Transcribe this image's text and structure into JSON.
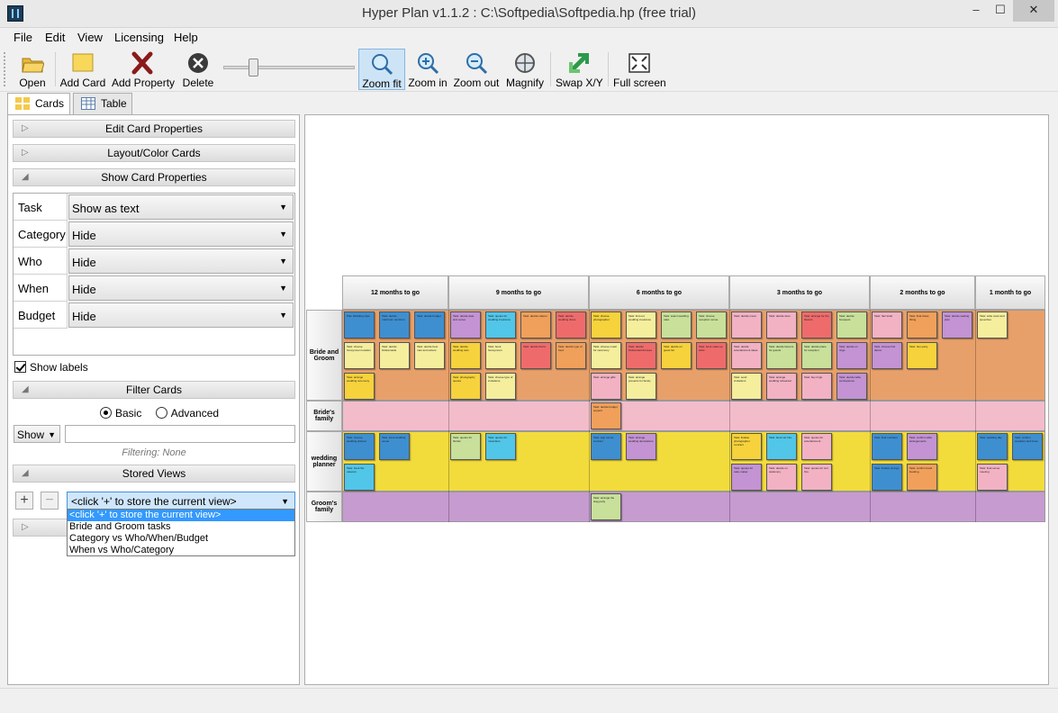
{
  "window": {
    "title": "Hyper Plan v1.1.2 : C:\\Softpedia\\Softpedia.hp (free trial)",
    "minimize": "–",
    "maximize": "☐",
    "close": "✕"
  },
  "menu": [
    "File",
    "Edit",
    "View",
    "Licensing",
    "Help"
  ],
  "toolbar": {
    "open": "Open",
    "add_card": "Add Card",
    "add_property": "Add Property",
    "delete": "Delete",
    "zoom_fit": "Zoom fit",
    "zoom_in": "Zoom in",
    "zoom_out": "Zoom out",
    "magnify": "Magnify",
    "swap": "Swap X/Y",
    "fullscreen": "Full screen",
    "active_tool": "Zoom fit"
  },
  "tabs": {
    "cards": "Cards",
    "table": "Table",
    "active": "Cards"
  },
  "panel": {
    "edit_props": "Edit Card Properties",
    "layout_color": "Layout/Color Cards",
    "show_props": "Show Card Properties",
    "properties": [
      {
        "label": "Task",
        "value": "Show as text"
      },
      {
        "label": "Category",
        "value": "Hide"
      },
      {
        "label": "Who",
        "value": "Hide"
      },
      {
        "label": "When",
        "value": "Hide"
      },
      {
        "label": "Budget",
        "value": "Hide"
      }
    ],
    "show_labels": "Show labels",
    "show_labels_checked": true,
    "filter_cards": "Filter Cards",
    "basic": "Basic",
    "advanced": "Advanced",
    "filter_mode": "Basic",
    "show_select": "Show",
    "filter_value": "",
    "filtering": "Filtering: None",
    "stored_views": "Stored Views",
    "add_view": "+",
    "remove_view": "−",
    "view_select": "<click '+' to store the current view>",
    "view_options": [
      "<click '+' to store the current view>",
      "Bride and Groom tasks",
      "Category vs Who/When/Budget",
      "When vs Who/Category"
    ]
  },
  "board": {
    "columns": [
      "12 months to go",
      "9 months to go",
      "6 months to go",
      "3 months to go",
      "2 months to go",
      "1 month to go"
    ],
    "rows": [
      "Bride and Groom",
      "Bride's family",
      "wedding planner",
      "Groom's family"
    ],
    "row_colors": [
      "#e8a06a",
      "#f3bccb",
      "#f2dc3c",
      "#c69bd0"
    ],
    "card_colors": {
      "blue": "#3e8fd0",
      "cyan": "#51c6e8",
      "yellow": "#f6d23c",
      "orange": "#f0a05a",
      "red": "#ef6b6b",
      "green": "#c8e09a",
      "lightyellow": "#f4ee9d",
      "pink": "#f2b2c4",
      "purple": "#c393d3"
    },
    "cards": [
      {
        "row": 0,
        "col": 0,
        "slot": 0,
        "line": 0,
        "color": "blue",
        "text": "Plan Wedding style"
      },
      {
        "row": 0,
        "col": 0,
        "slot": 1,
        "line": 0,
        "color": "blue",
        "text": "Task: decide maximum numbers"
      },
      {
        "row": 0,
        "col": 0,
        "slot": 2,
        "line": 0,
        "color": "blue",
        "text": "Task: decide budget"
      },
      {
        "row": 0,
        "col": 0,
        "slot": 0,
        "line": 1,
        "color": "lightyellow",
        "text": "Task: choose honeymoon location"
      },
      {
        "row": 0,
        "col": 0,
        "slot": 1,
        "line": 1,
        "color": "lightyellow",
        "text": "Task: decide bridesmaids"
      },
      {
        "row": 0,
        "col": 0,
        "slot": 2,
        "line": 1,
        "color": "lightyellow",
        "text": "Task: decide best man and ushers"
      },
      {
        "row": 0,
        "col": 0,
        "slot": 0,
        "line": 2,
        "color": "yellow",
        "text": "Task: arrange wedding ceremony"
      },
      {
        "row": 0,
        "col": 1,
        "slot": 0,
        "line": 0,
        "color": "purple",
        "text": "Task: decide date and venue"
      },
      {
        "row": 0,
        "col": 1,
        "slot": 1,
        "line": 0,
        "color": "cyan",
        "text": "Task: quotes for wedding insurance"
      },
      {
        "row": 0,
        "col": 1,
        "slot": 2,
        "line": 0,
        "color": "orange",
        "text": "Task: decide caterer"
      },
      {
        "row": 0,
        "col": 1,
        "slot": 3,
        "line": 0,
        "color": "red",
        "text": "Task: decide wedding dress"
      },
      {
        "row": 0,
        "col": 1,
        "slot": 0,
        "line": 1,
        "color": "yellow",
        "text": "Task: decide wedding cars"
      },
      {
        "row": 0,
        "col": 1,
        "slot": 1,
        "line": 1,
        "color": "lightyellow",
        "text": "Task: book honeymoon"
      },
      {
        "row": 0,
        "col": 1,
        "slot": 2,
        "line": 1,
        "color": "red",
        "text": "Task: decide florist"
      },
      {
        "row": 0,
        "col": 1,
        "slot": 3,
        "line": 1,
        "color": "orange",
        "text": "Task: decide type of food"
      },
      {
        "row": 0,
        "col": 1,
        "slot": 0,
        "line": 2,
        "color": "yellow",
        "text": "Task: photography quotes"
      },
      {
        "row": 0,
        "col": 1,
        "slot": 1,
        "line": 2,
        "color": "lightyellow",
        "text": "Task: choose type of invitations"
      },
      {
        "row": 0,
        "col": 2,
        "slot": 0,
        "line": 0,
        "color": "yellow",
        "text": "Task: choose photographer"
      },
      {
        "row": 0,
        "col": 2,
        "slot": 1,
        "line": 0,
        "color": "lightyellow",
        "text": "Task: find out wedding insurance"
      },
      {
        "row": 0,
        "col": 2,
        "slot": 2,
        "line": 0,
        "color": "green",
        "text": "Task: select wedding cake"
      },
      {
        "row": 0,
        "col": 2,
        "slot": 3,
        "line": 0,
        "color": "green",
        "text": "Task: choose reception venue"
      },
      {
        "row": 0,
        "col": 2,
        "slot": 0,
        "line": 1,
        "color": "lightyellow",
        "text": "Task: choose music for ceremony"
      },
      {
        "row": 0,
        "col": 2,
        "slot": 1,
        "line": 1,
        "color": "red",
        "text": "Task: decide bridesmaid dresses"
      },
      {
        "row": 0,
        "col": 2,
        "slot": 2,
        "line": 1,
        "color": "yellow",
        "text": "Task: decide on guest list"
      },
      {
        "row": 0,
        "col": 2,
        "slot": 3,
        "line": 1,
        "color": "red",
        "text": "Task: book make up artist"
      },
      {
        "row": 0,
        "col": 2,
        "slot": 0,
        "line": 2,
        "color": "pink",
        "text": "Task: arrange gifts"
      },
      {
        "row": 0,
        "col": 2,
        "slot": 1,
        "line": 2,
        "color": "lightyellow",
        "text": "Task: arrange presents for family"
      },
      {
        "row": 0,
        "col": 3,
        "slot": 0,
        "line": 0,
        "color": "pink",
        "text": "Task: decide menu"
      },
      {
        "row": 0,
        "col": 3,
        "slot": 1,
        "line": 0,
        "color": "pink",
        "text": "Task: decide wine"
      },
      {
        "row": 0,
        "col": 3,
        "slot": 2,
        "line": 0,
        "color": "red",
        "text": "Task: arrange for the flowers"
      },
      {
        "row": 0,
        "col": 3,
        "slot": 3,
        "line": 0,
        "color": "green",
        "text": "Task: decide bouquets"
      },
      {
        "row": 0,
        "col": 3,
        "slot": 0,
        "line": 1,
        "color": "pink",
        "text": "Task: decide entertainment ideas"
      },
      {
        "row": 0,
        "col": 3,
        "slot": 1,
        "line": 1,
        "color": "green",
        "text": "Task: decide favours for guests"
      },
      {
        "row": 0,
        "col": 3,
        "slot": 2,
        "line": 1,
        "color": "green",
        "text": "Task: decide place for reception"
      },
      {
        "row": 0,
        "col": 3,
        "slot": 3,
        "line": 1,
        "color": "purple",
        "text": "Task: decide on rings"
      },
      {
        "row": 0,
        "col": 3,
        "slot": 0,
        "line": 2,
        "color": "lightyellow",
        "text": "Task: send invitations"
      },
      {
        "row": 0,
        "col": 3,
        "slot": 1,
        "line": 2,
        "color": "pink",
        "text": "Task: arrange wedding rehearsal"
      },
      {
        "row": 0,
        "col": 3,
        "slot": 2,
        "line": 2,
        "color": "pink",
        "text": "Task: buy rings"
      },
      {
        "row": 0,
        "col": 3,
        "slot": 3,
        "line": 2,
        "color": "purple",
        "text": "Task: decide table centrepieces"
      },
      {
        "row": 0,
        "col": 4,
        "slot": 0,
        "line": 0,
        "color": "pink",
        "text": "Task: hair trials"
      },
      {
        "row": 0,
        "col": 4,
        "slot": 1,
        "line": 0,
        "color": "orange",
        "text": "Task: final dress fitting"
      },
      {
        "row": 0,
        "col": 4,
        "slot": 2,
        "line": 0,
        "color": "purple",
        "text": "Task: decide seating plan"
      },
      {
        "row": 0,
        "col": 4,
        "slot": 0,
        "line": 1,
        "color": "purple",
        "text": "Task: choose first dance"
      },
      {
        "row": 0,
        "col": 4,
        "slot": 1,
        "line": 1,
        "color": "yellow",
        "text": "Task: hen party"
      },
      {
        "row": 0,
        "col": 5,
        "slot": 0,
        "line": 0,
        "color": "lightyellow",
        "text": "Task: write vows and speeches"
      },
      {
        "row": 1,
        "col": 2,
        "slot": 0,
        "line": 0,
        "color": "orange",
        "text": "Task: decide budget support"
      },
      {
        "row": 2,
        "col": 0,
        "slot": 0,
        "line": 0,
        "color": "blue",
        "text": "Task: choose wedding planner"
      },
      {
        "row": 2,
        "col": 0,
        "slot": 1,
        "line": 0,
        "color": "blue",
        "text": "Task: book wedding venue"
      },
      {
        "row": 2,
        "col": 0,
        "slot": 0,
        "line": 1,
        "color": "cyan",
        "text": "Task: book the caterers"
      },
      {
        "row": 2,
        "col": 1,
        "slot": 0,
        "line": 0,
        "color": "green",
        "text": "Task: quotes for florists"
      },
      {
        "row": 2,
        "col": 1,
        "slot": 1,
        "line": 0,
        "color": "cyan",
        "text": "Task: quotes for musicians"
      },
      {
        "row": 2,
        "col": 2,
        "slot": 0,
        "line": 0,
        "color": "blue",
        "text": "Task: sign venue contract"
      },
      {
        "row": 2,
        "col": 2,
        "slot": 1,
        "line": 0,
        "color": "purple",
        "text": "Task: arrange wedding decorations"
      },
      {
        "row": 2,
        "col": 3,
        "slot": 0,
        "line": 0,
        "color": "yellow",
        "text": "Task: finalise photographer contract"
      },
      {
        "row": 2,
        "col": 3,
        "slot": 1,
        "line": 0,
        "color": "cyan",
        "text": "Task: book car hire"
      },
      {
        "row": 2,
        "col": 3,
        "slot": 2,
        "line": 0,
        "color": "pink",
        "text": "Task: quotes for entertainment"
      },
      {
        "row": 2,
        "col": 3,
        "slot": 0,
        "line": 1,
        "color": "purple",
        "text": "Task: quotes for cake maker"
      },
      {
        "row": 2,
        "col": 3,
        "slot": 1,
        "line": 1,
        "color": "pink",
        "text": "Task: decide on stationery"
      },
      {
        "row": 2,
        "col": 3,
        "slot": 2,
        "line": 1,
        "color": "pink",
        "text": "Task: quotes for suit hire"
      },
      {
        "row": 2,
        "col": 4,
        "slot": 0,
        "line": 0,
        "color": "blue",
        "text": "Task: final numbers"
      },
      {
        "row": 2,
        "col": 4,
        "slot": 1,
        "line": 0,
        "color": "purple",
        "text": "Task: confirm table arrangements"
      },
      {
        "row": 2,
        "col": 4,
        "slot": 0,
        "line": 1,
        "color": "blue",
        "text": "Task: finalise timings"
      },
      {
        "row": 2,
        "col": 4,
        "slot": 1,
        "line": 1,
        "color": "orange",
        "text": "Task: confirm band booking"
      },
      {
        "row": 2,
        "col": 5,
        "slot": 0,
        "line": 0,
        "color": "blue",
        "text": "Task: wedding day"
      },
      {
        "row": 2,
        "col": 5,
        "slot": 1,
        "line": 0,
        "color": "blue",
        "text": "Task: confirm suppliers and times"
      },
      {
        "row": 2,
        "col": 5,
        "slot": 0,
        "line": 1,
        "color": "pink",
        "text": "Task: final venue meeting"
      },
      {
        "row": 3,
        "col": 2,
        "slot": 0,
        "line": 0,
        "color": "green",
        "text": "Task: arrange the stag party"
      }
    ]
  }
}
